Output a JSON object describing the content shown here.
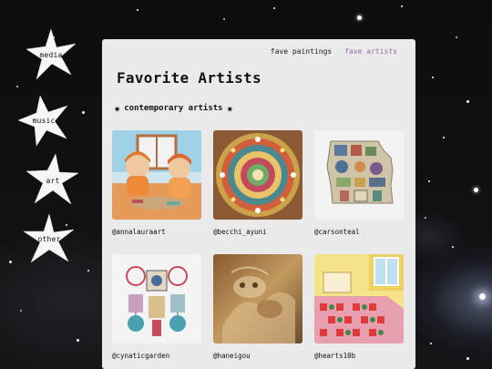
{
  "side_nav": [
    {
      "label": "media"
    },
    {
      "label": "music"
    },
    {
      "label": "art"
    },
    {
      "label": "other"
    }
  ],
  "top_nav": [
    {
      "label": "fave paintings",
      "active": false
    },
    {
      "label": "fave artists",
      "active": true
    }
  ],
  "page_title": "Favorite Artists",
  "section": {
    "title": "contemporary artists",
    "icon": "star-icon"
  },
  "artists": [
    {
      "handle": "@annalauraart"
    },
    {
      "handle": "@becchi_ayuni"
    },
    {
      "handle": "@carsonteal"
    },
    {
      "handle": "@cynaticgarden"
    },
    {
      "handle": "@haneigou"
    },
    {
      "handle": "@hearts10b"
    }
  ],
  "colors": {
    "panel": "#eaeaea",
    "active_link": "#9a6aa8",
    "background": "#0b0b0d",
    "text": "#111111"
  }
}
